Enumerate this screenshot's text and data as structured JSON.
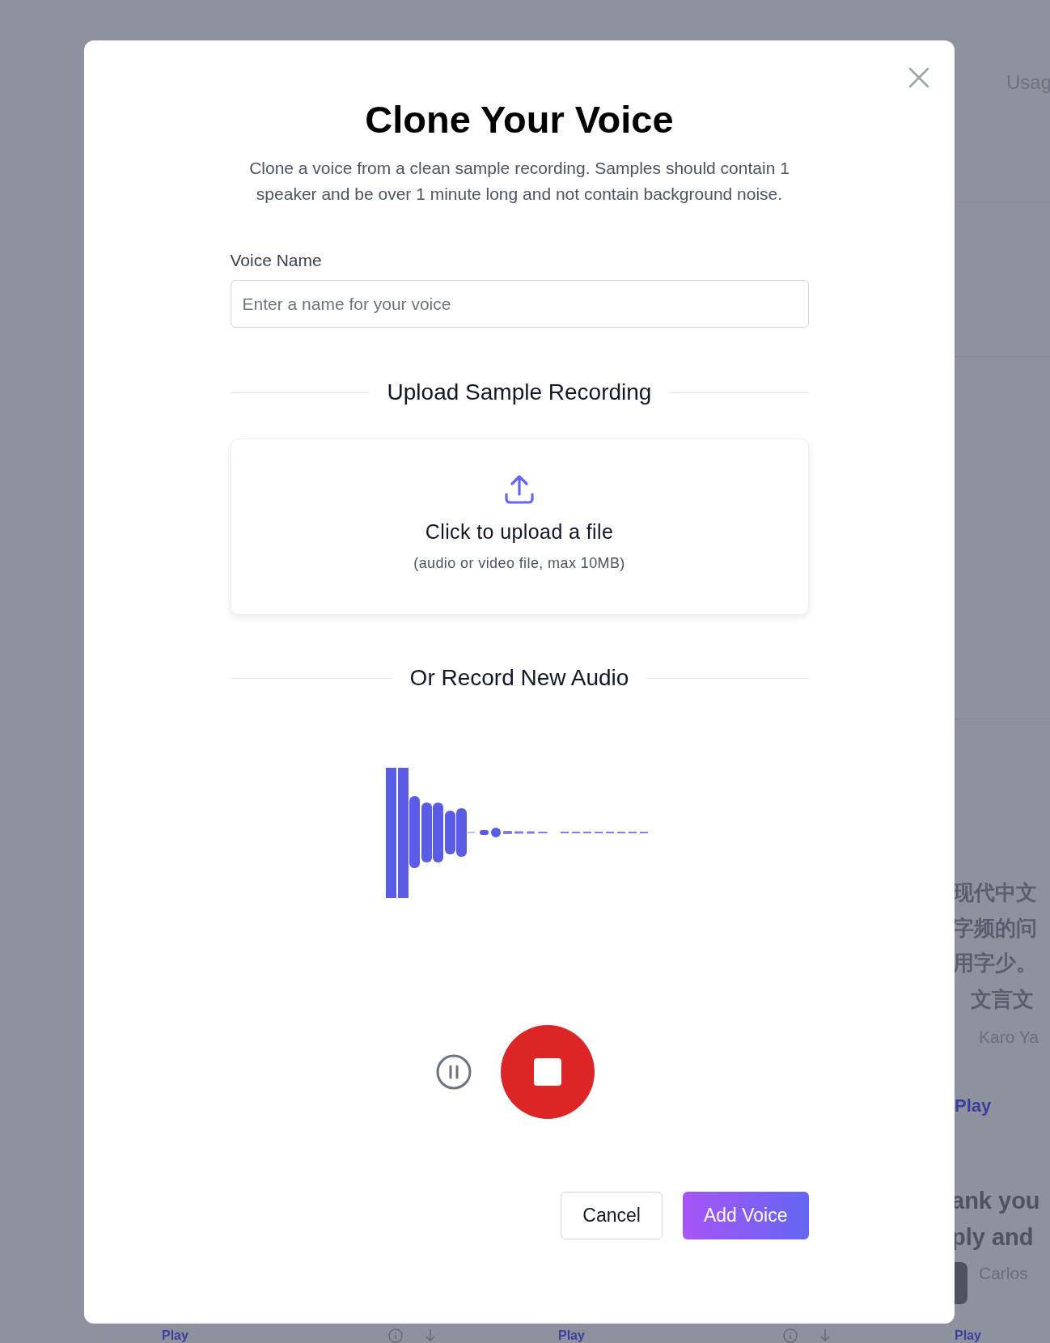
{
  "background": {
    "tab_label": "Usag",
    "text_lines": [
      "现代中文",
      "字频的问",
      "用字少。",
      "文言文"
    ],
    "author": "Karo Ya",
    "play_link": "Play",
    "quote_lines": [
      "ank you",
      "ply and"
    ],
    "author_2": "Carlos",
    "footer_plays": [
      "Play",
      "Play",
      "Play"
    ]
  },
  "modal": {
    "title": "Clone Your Voice",
    "description": "Clone a voice from a clean sample recording. Samples should contain 1 speaker and be over 1 minute long and not contain background noise.",
    "voice_name": {
      "label": "Voice Name",
      "placeholder": "Enter a name for your voice"
    },
    "upload_section": {
      "heading": "Upload Sample Recording",
      "prompt": "Click to upload a file",
      "hint": "(audio or video file, max 10MB)"
    },
    "record_section": {
      "heading": "Or Record New Audio"
    },
    "buttons": [
      {
        "label": "Cancel",
        "kind": "secondary"
      },
      {
        "label": "Add Voice",
        "kind": "primary"
      }
    ]
  }
}
